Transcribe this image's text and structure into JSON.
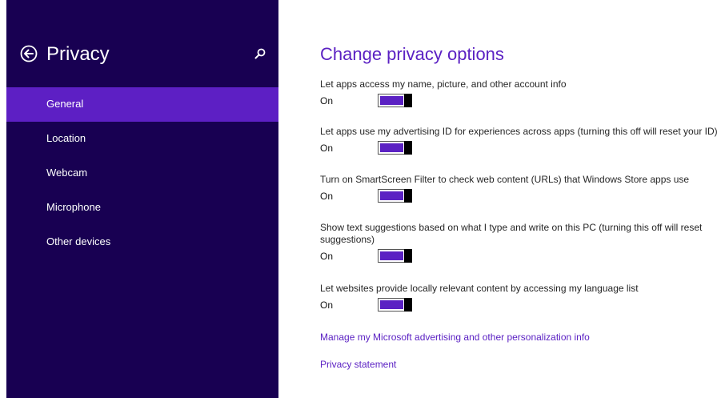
{
  "sidebar": {
    "title": "Privacy",
    "back_icon": "back-arrow-circle-icon",
    "search_icon": "search-icon",
    "items": [
      {
        "label": "General",
        "selected": true
      },
      {
        "label": "Location"
      },
      {
        "label": "Webcam"
      },
      {
        "label": "Microphone"
      },
      {
        "label": "Other devices"
      }
    ]
  },
  "main": {
    "title": "Change privacy options",
    "settings": [
      {
        "description": "Let apps access my name, picture, and other account info",
        "state": "On"
      },
      {
        "description": "Let apps use my advertising ID for experiences across apps (turning this off will reset your ID)",
        "state": "On"
      },
      {
        "description": "Turn on SmartScreen Filter to check web content (URLs) that Windows Store apps use",
        "state": "On"
      },
      {
        "description": "Show text suggestions based on what I type and write on this PC (turning this off will reset suggestions)",
        "state": "On"
      },
      {
        "description": "Let websites provide locally relevant content by accessing my language list",
        "state": "On"
      }
    ],
    "links": [
      {
        "label": "Manage my Microsoft advertising and other personalization info"
      },
      {
        "label": "Privacy statement"
      }
    ]
  },
  "colors": {
    "sidebar_bg": "#180052",
    "selected_bg": "#5d1fc4",
    "accent": "#5b21c3"
  }
}
